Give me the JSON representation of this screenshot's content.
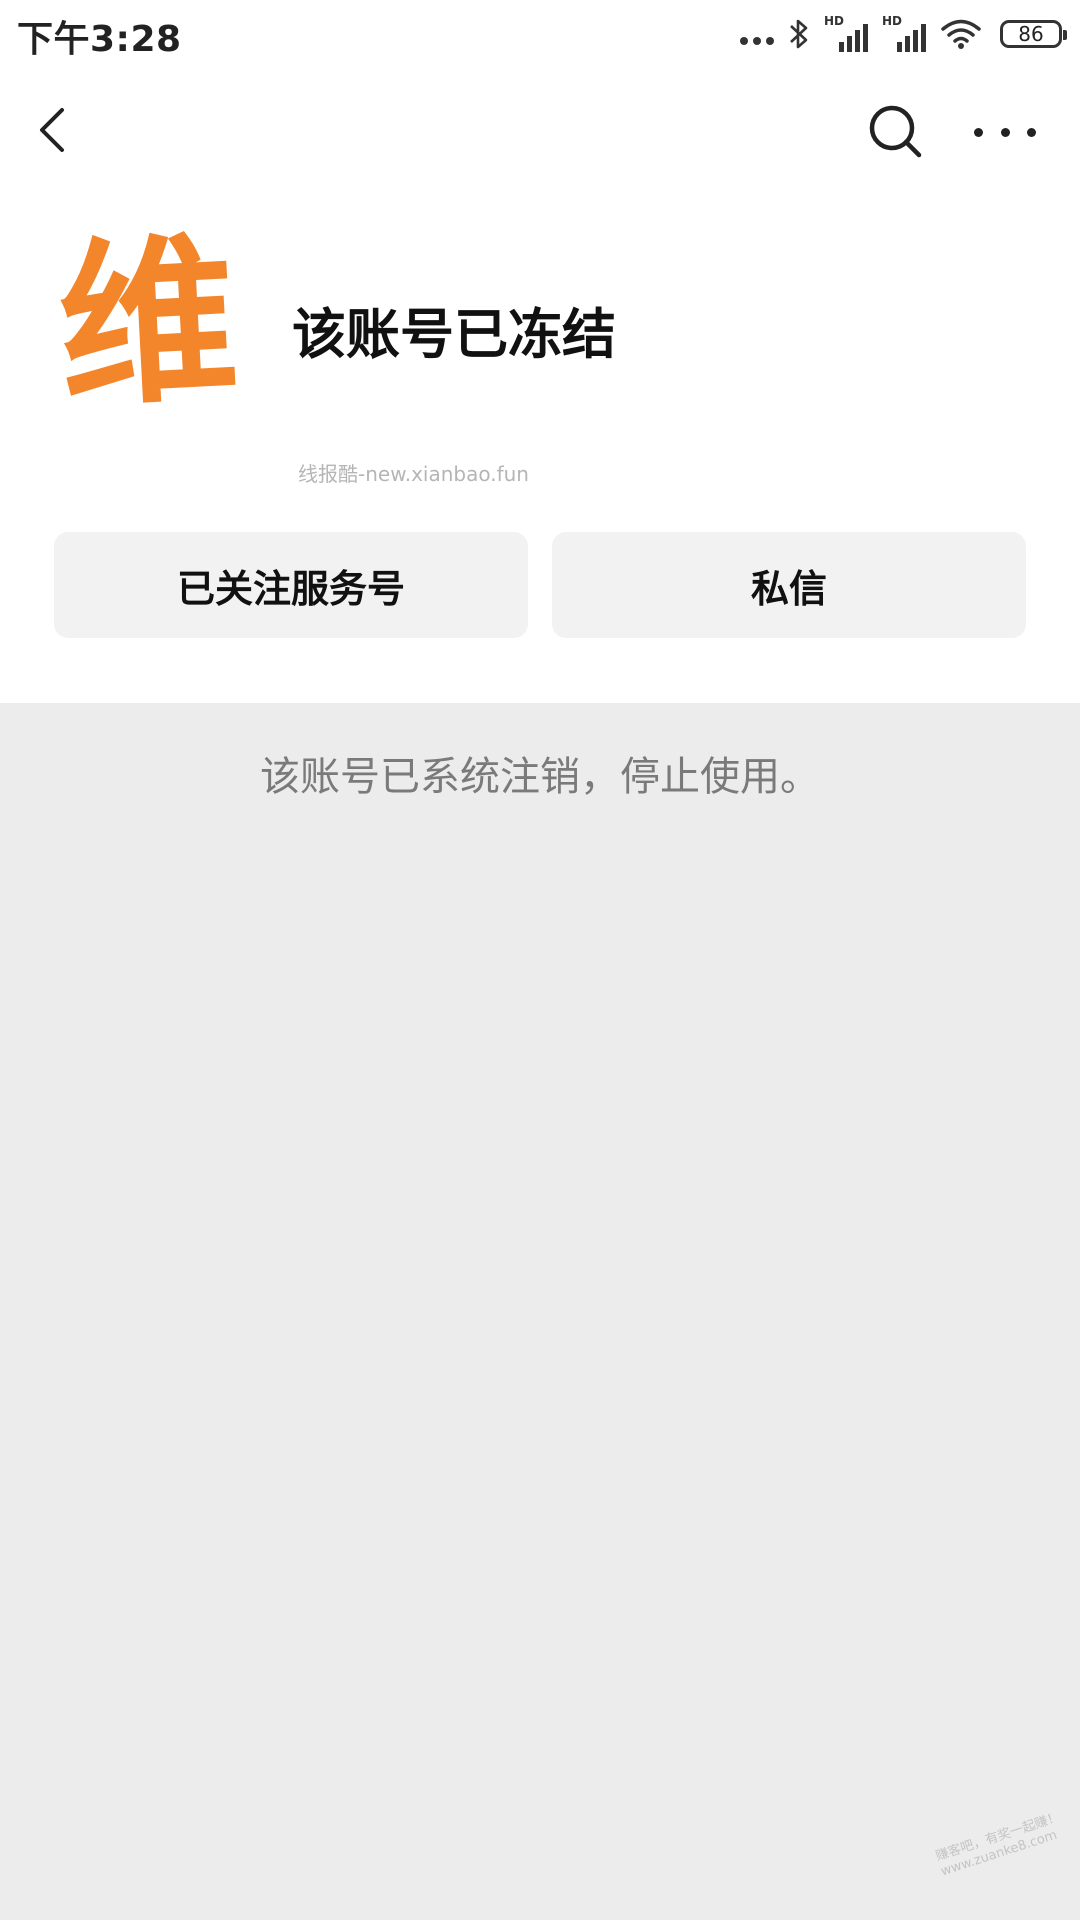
{
  "status_bar": {
    "time": "下午3:28",
    "hd_label": "HD",
    "battery": "86"
  },
  "nav": {
    "back_icon": "chevron-left-icon",
    "search_icon": "search-icon",
    "more_icon": "more-horizontal-icon"
  },
  "profile": {
    "avatar_char": "维",
    "name": "该账号已冻结",
    "watermark": "线报酷-new.xianbao.fun"
  },
  "actions": {
    "follow_label": "已关注服务号",
    "message_label": "私信"
  },
  "notice": "该账号已系统注销，停止使用。",
  "footer_watermark": {
    "line1": "赚客吧，有奖一起赚！",
    "line2": "www.zuanke8.com"
  },
  "colors": {
    "avatar": "#f3852b",
    "page_background": "#ececec",
    "button_background": "#f2f2f2"
  }
}
